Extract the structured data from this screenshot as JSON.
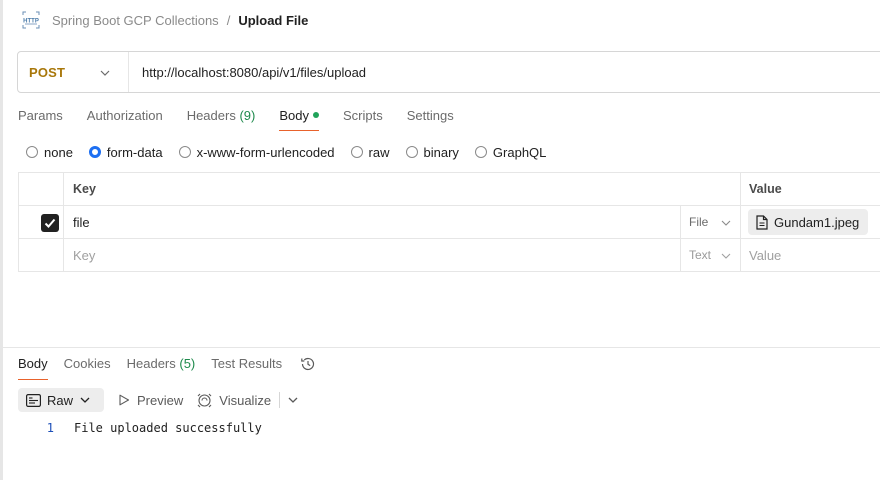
{
  "breadcrumb": {
    "collection": "Spring Boot GCP Collections",
    "separator": "/",
    "current": "Upload File"
  },
  "request": {
    "method": "POST",
    "url": "http://localhost:8080/api/v1/files/upload"
  },
  "request_tabs": {
    "params": "Params",
    "authorization": "Authorization",
    "headers": "Headers",
    "headers_count": "(9)",
    "body": "Body",
    "scripts": "Scripts",
    "settings": "Settings"
  },
  "body_types": {
    "none": "none",
    "form_data": "form-data",
    "urlencoded": "x-www-form-urlencoded",
    "raw": "raw",
    "binary": "binary",
    "graphql": "GraphQL",
    "selected": "form-data"
  },
  "table": {
    "headers": {
      "key": "Key",
      "value": "Value"
    },
    "rows": [
      {
        "checked": true,
        "key": "file",
        "type": "File",
        "value": "Gundam1.jpeg"
      }
    ],
    "empty_row": {
      "key_placeholder": "Key",
      "type": "Text",
      "value_placeholder": "Value"
    }
  },
  "response_tabs": {
    "body": "Body",
    "cookies": "Cookies",
    "headers": "Headers",
    "headers_count": "(5)",
    "test_results": "Test Results"
  },
  "response_toolbar": {
    "format": "Raw",
    "preview": "Preview",
    "visualize": "Visualize"
  },
  "response_body": {
    "lines": [
      {
        "number": "1",
        "text": "File uploaded successfully"
      }
    ]
  },
  "colors": {
    "method": "#a8770a",
    "accent": "#e8622c",
    "radio": "#1d6ff2",
    "count": "#1e8a4c"
  }
}
